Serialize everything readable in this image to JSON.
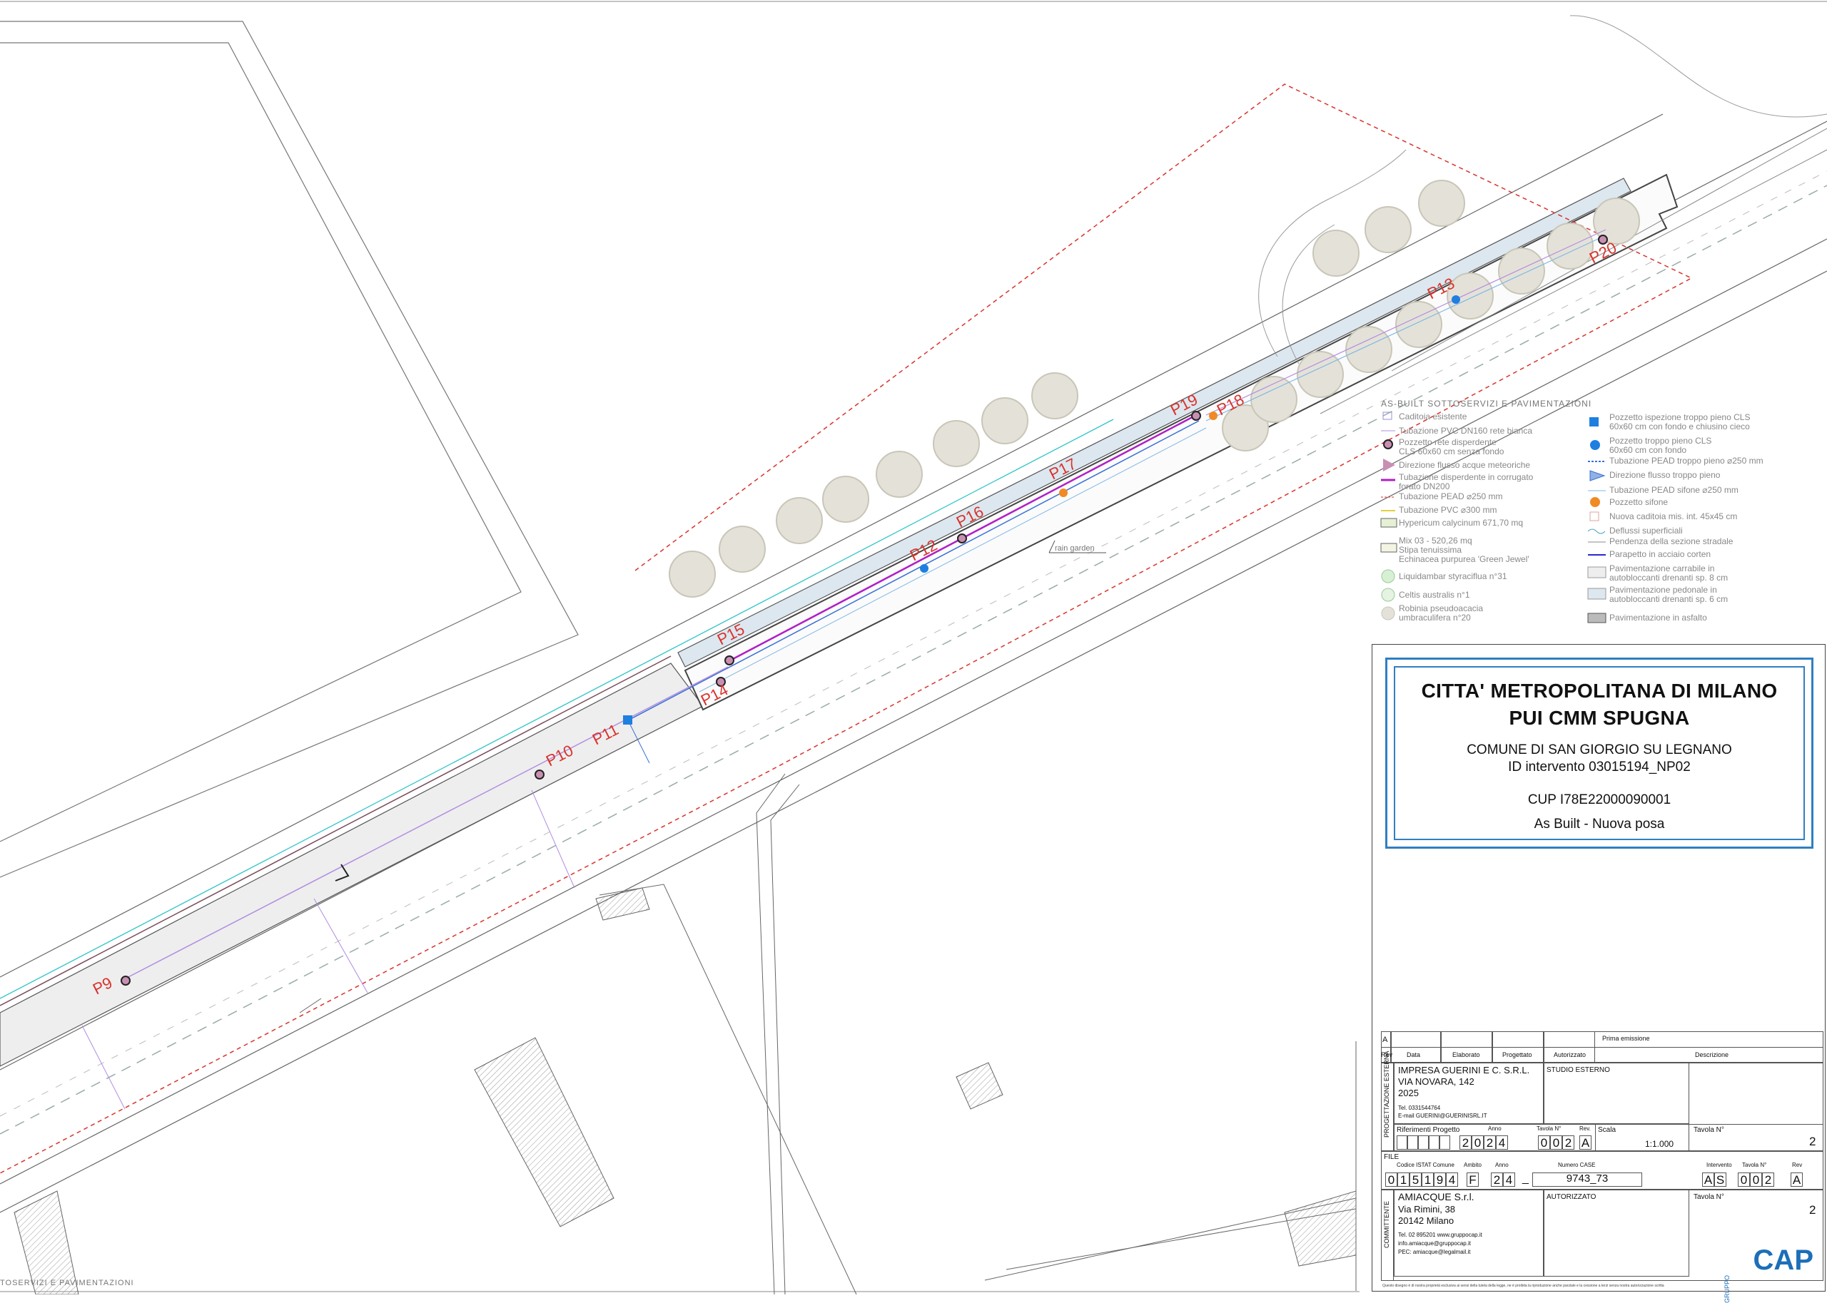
{
  "map": {
    "wells": [
      "P9",
      "P10",
      "P11",
      "P12",
      "P13",
      "P14",
      "P15",
      "P16",
      "P17",
      "P18",
      "P19",
      "P20"
    ],
    "annotation_rain_garden": "rain garden",
    "bottom_left_legend_title": "TOSERVIZI E PAVIMENTAZIONI"
  },
  "legend": {
    "title": "AS-BUILT SOTTOSERVIZI E PAVIMENTAZIONI",
    "left_items": [
      "Caditoia esistente",
      "Tubazione PVC DN160 rete bianca",
      "Pozzetto rete disperdente",
      "CLS 60x60 cm senza fondo",
      "Direzione flusso acque meteoriche",
      "Tubazione disperdente in corrugato",
      "forato DN200",
      "Tubazione PEAD ⌀250 mm",
      "Tubazione PVC ⌀300 mm",
      "Hypericum calycinum 671,70 mq",
      "Mix 03 - 520,26 mq",
      "Stipa tenuissima",
      "Echinacea purpurea 'Green Jewel'",
      "Liquidambar styraciflua n°31",
      "Celtis australis n°1",
      "Robinia pseudoacacia",
      "umbraculifera n°20"
    ],
    "right_items": [
      "Pozzetto ispezione troppo pieno CLS",
      "60x60 cm con fondo e chiusino cieco",
      "Pozzetto troppo pieno CLS",
      "60x60 cm con fondo",
      "Tubazione PEAD troppo pieno ⌀250 mm",
      "Direzione flusso troppo pieno",
      "Tubazione PEAD sifone ⌀250 mm",
      "Pozzetto sifone",
      "Nuova caditoia mis. int. 45x45 cm",
      "Deflussi superficiali",
      "Pendenza della sezione stradale",
      "Parapetto in acciaio corten",
      "Pavimentazione carrabile in",
      "autobloccanti drenanti sp. 8 cm",
      "Pavimentazione pedonale in",
      "autobloccanti drenanti sp. 6 cm",
      "Pavimentazione in asfalto"
    ]
  },
  "title_block": {
    "line1": "CITTA' METROPOLITANA DI MILANO",
    "line2": "PUI CMM SPUGNA",
    "comune": "COMUNE DI SAN GIORGIO SU LEGNANO",
    "id_intervento": "ID intervento 03015194_NP02",
    "cup": "CUP I78E22000090001",
    "as_built": "As Built - Nuova posa",
    "rev_a": "A",
    "prima_emissione": "Prima emissione",
    "col_rev": "Rev",
    "col_data": "Data",
    "col_elaborato": "Elaborato",
    "col_progettato": "Progettato",
    "col_autorizzato": "Autorizzato",
    "col_descrizione": "Descrizione",
    "prog_esterna_label": "PROGETTAZIONE ESTERNA",
    "impresa": "IMPRESA GUERINI E C. S.R.L.",
    "impresa_via": "VIA NOVARA, 142",
    "impresa_year": "2025",
    "impresa_tel": "Tel. 0331544764",
    "impresa_email": "E-mail GUERINI@GUERINISRL.IT",
    "studio_esterno": "STUDIO ESTERNO",
    "riferimenti_progetto": "Riferimenti Progetto",
    "anno_label": "Anno",
    "anno_digits": [
      "2",
      "0",
      "2",
      "4"
    ],
    "tavola_label": "Tavola N°",
    "tavola_digits": [
      "0",
      "0",
      "2"
    ],
    "rev_label": "Rev.",
    "rev_value": "A",
    "scala_label": "Scala",
    "scala_value": "1:1.000",
    "tavola_n_label": "Tavola N°",
    "tavola_n_value": "2",
    "file_label": "FILE",
    "codice_istat_label": "Codice ISTAT Comune",
    "codice_istat_digits": [
      "0",
      "1",
      "5",
      "1",
      "9",
      "4"
    ],
    "ambito_label": "Ambito",
    "ambito_value": "F",
    "anno2_label": "Anno",
    "anno2_digits": [
      "2",
      "4"
    ],
    "numero_case_label": "Numero CASE",
    "numero_case_value": "9743_73",
    "intervento_label": "Intervento",
    "intervento_digits": [
      "A",
      "S"
    ],
    "tavola2_label": "Tavola N°",
    "tavola2_digits": [
      "0",
      "0",
      "2"
    ],
    "rev2_label": "Rev",
    "rev2_value": "A",
    "committente_label": "COMMITTENTE",
    "amiacque": "AMIACQUE S.r.l.",
    "amiacque_via": "Via Rimini, 38",
    "amiacque_city": "20142 Milano",
    "amiacque_tel": "Tel. 02 895201 www.gruppocap.it",
    "amiacque_info": "info.amiacque@gruppocap.it",
    "amiacque_pec": "PEC: amiacque@legalmail.it",
    "autorizzato": "AUTORIZZATO",
    "tavola3_label": "Tavola N°",
    "tavola3_value": "2",
    "gruppo": "GRUPPO",
    "cap_logo": "CAP",
    "footer_note": "Questo disegno è di nostra proprietà esclusiva ai sensi della tutela della legge, ne è proibita la riproduzione anche parziale e la cessione a terzi senza nostra autorizzazione scritta"
  },
  "colors": {
    "red_dashed": "#d9332c",
    "blue_frame": "#2f7fc1",
    "magenta_pipe": "#b01fc7",
    "blue_pipe": "#3a6fd8",
    "orange_well": "#f08a24",
    "blue_well": "#1f7fe0",
    "pavement_grey": "#e8e8e8",
    "pavement_blue": "#dde7ef",
    "tree": "#e4e2d8"
  }
}
